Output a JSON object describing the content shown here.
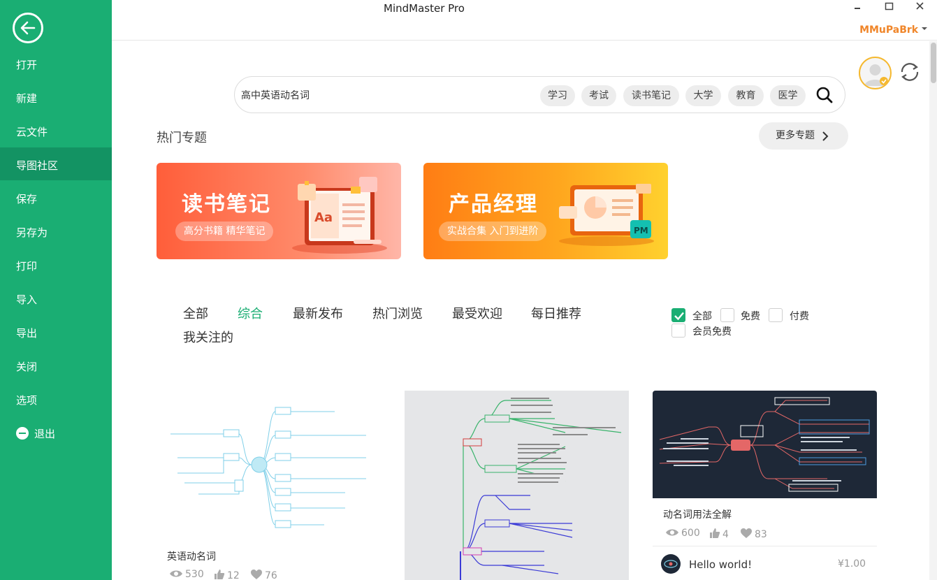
{
  "window": {
    "title": "MindMaster Pro",
    "user_name": "MMuPaBrk"
  },
  "sidebar": {
    "items": [
      {
        "label": "打开"
      },
      {
        "label": "新建"
      },
      {
        "label": "云文件"
      },
      {
        "label": "导图社区",
        "active": true
      },
      {
        "label": "保存"
      },
      {
        "label": "另存为"
      },
      {
        "label": "打印"
      },
      {
        "label": "导入"
      },
      {
        "label": "导出"
      },
      {
        "label": "关闭"
      },
      {
        "label": "选项"
      }
    ],
    "exit_label": "退出"
  },
  "search": {
    "value": "高中英语动名词",
    "tags": [
      "学习",
      "考试",
      "读书笔记",
      "大学",
      "教育",
      "医学"
    ]
  },
  "hot_topics": {
    "title": "热门专题",
    "more_label": "更多专题",
    "banners": [
      {
        "title": "读书笔记",
        "subtitle": "高分书籍 精华笔记"
      },
      {
        "title": "产品经理",
        "subtitle": "实战合集 入门到进阶"
      }
    ]
  },
  "filter_tabs": [
    {
      "label": "全部"
    },
    {
      "label": "综合",
      "active": true
    },
    {
      "label": "最新发布"
    },
    {
      "label": "热门浏览"
    },
    {
      "label": "最受欢迎"
    },
    {
      "label": "每日推荐"
    },
    {
      "label": "我关注的"
    }
  ],
  "price_filters": [
    {
      "label": "全部",
      "checked": true
    },
    {
      "label": "免费",
      "checked": false
    },
    {
      "label": "付费",
      "checked": false
    },
    {
      "label": "会员免费",
      "checked": false
    }
  ],
  "cards": [
    {
      "title": "英语动名词",
      "views": "530",
      "likes": "12",
      "favorites": "76"
    },
    {
      "title": "",
      "views": "",
      "likes": "",
      "favorites": ""
    },
    {
      "title": "动名词用法全解",
      "views": "600",
      "likes": "4",
      "favorites": "83",
      "author": "Hello world!",
      "price": "¥1.00"
    }
  ],
  "colors": {
    "brand_green": "#1aae73",
    "sidebar_active": "#139363",
    "user_orange": "#f0862a"
  }
}
